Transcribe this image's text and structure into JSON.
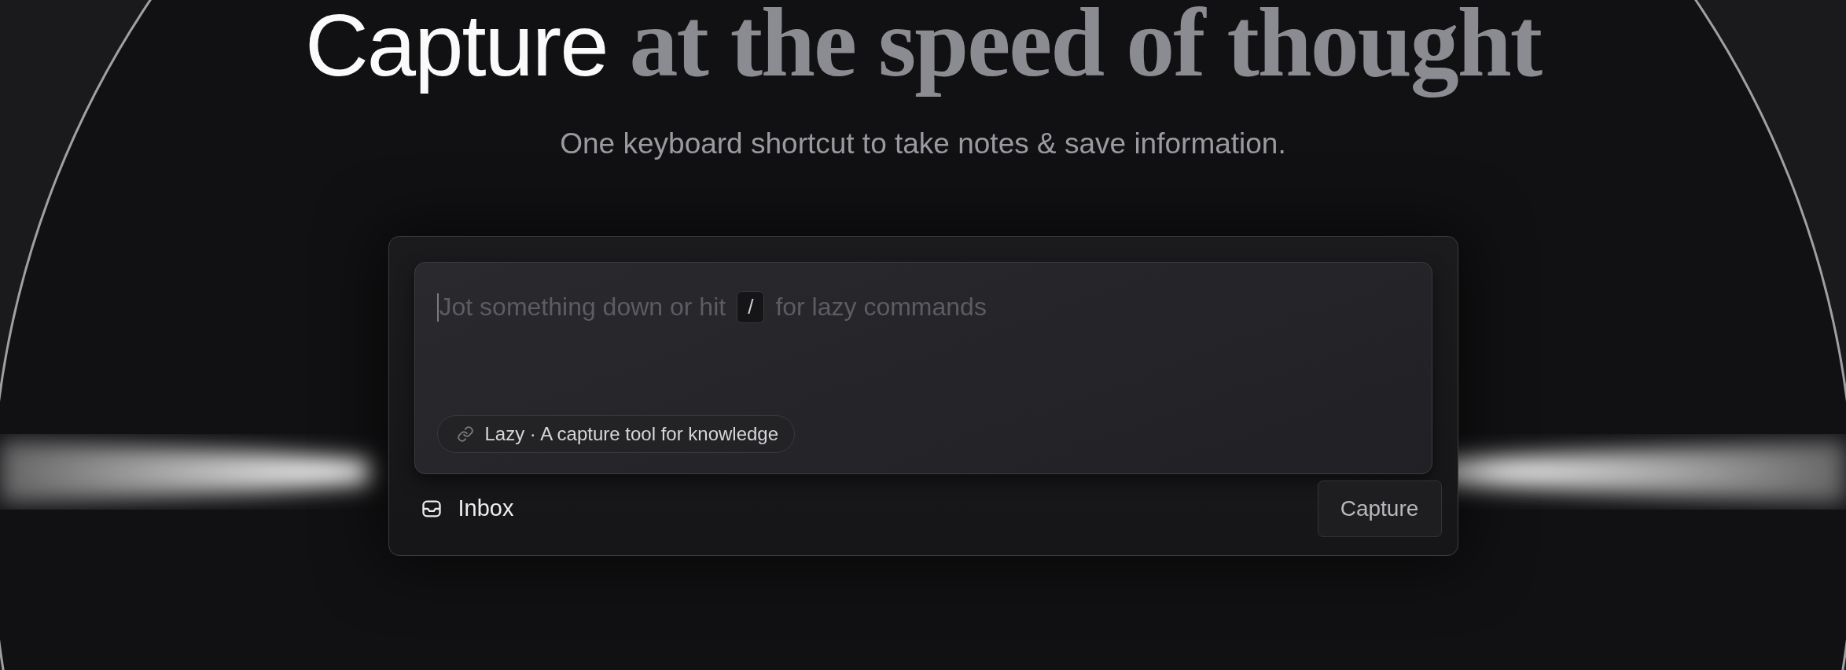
{
  "hero": {
    "title_lead": "Capture",
    "title_emphasis": "at the speed of thought",
    "subtitle": "One keyboard shortcut to take notes & save information."
  },
  "capture_card": {
    "placeholder_before": "Jot something down or hit",
    "shortcut_key": "/",
    "placeholder_after": "for lazy commands",
    "link_chip": "Lazy · A capture tool for knowledge",
    "destination": "Inbox",
    "button": "Capture"
  }
}
